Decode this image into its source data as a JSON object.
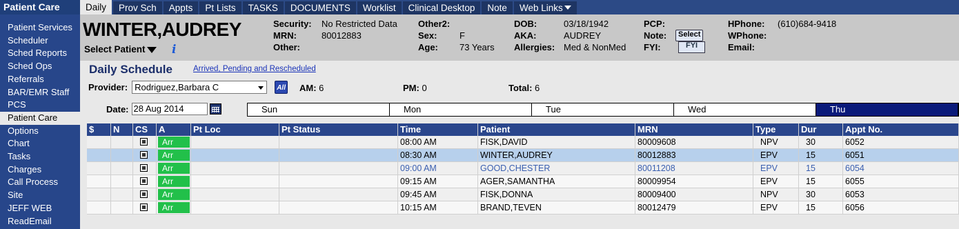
{
  "app": {
    "name": "Patient Care"
  },
  "tabs": [
    {
      "label": "Daily"
    },
    {
      "label": "Prov Sch"
    },
    {
      "label": "Appts"
    },
    {
      "label": "Pt Lists"
    },
    {
      "label": "TASKS"
    },
    {
      "label": "DOCUMENTS"
    },
    {
      "label": "Worklist"
    },
    {
      "label": "Clinical Desktop"
    },
    {
      "label": "Note"
    },
    {
      "label": "Web Links"
    }
  ],
  "sidebar": {
    "items": [
      {
        "label": "Patient Services"
      },
      {
        "label": "Scheduler"
      },
      {
        "label": "Sched Reports"
      },
      {
        "label": "Sched Ops"
      },
      {
        "label": "Referrals"
      },
      {
        "label": "BAR/EMR Staff"
      },
      {
        "label": "PCS"
      },
      {
        "label": "Patient Care"
      },
      {
        "label": "Options"
      },
      {
        "label": "Chart"
      },
      {
        "label": "Tasks"
      },
      {
        "label": "Charges"
      },
      {
        "label": "Call Process"
      },
      {
        "label": "Site"
      },
      {
        "label": "JEFF WEB"
      },
      {
        "label": "ReadEmail"
      }
    ]
  },
  "patient": {
    "name": "WINTER,AUDREY",
    "select_label": "Select Patient",
    "security_label": "Security:",
    "security": "No Restricted Data",
    "mrn_label": "MRN:",
    "mrn": "80012883",
    "other_label": "Other:",
    "other": "",
    "other2_label": "Other2:",
    "other2": "",
    "sex_label": "Sex:",
    "sex": "F",
    "age_label": "Age:",
    "age": "73 Years",
    "dob_label": "DOB:",
    "dob": "03/18/1942",
    "aka_label": "AKA:",
    "aka": "AUDREY",
    "allergies_label": "Allergies:",
    "allergies": "Med & NonMed",
    "pcp_label": "PCP:",
    "pcp": "",
    "note_label": "Note:",
    "note_button": "Select",
    "fyi_label": "FYI:",
    "fyi_button": "FYI",
    "hphone_label": "HPhone:",
    "hphone": "(610)684-9418",
    "wphone_label": "WPhone:",
    "wphone": "",
    "email_label": "Email:",
    "email": ""
  },
  "schedule": {
    "title": "Daily Schedule",
    "link": "Arrived, Pending and Rescheduled",
    "provider_label": "Provider:",
    "provider": "Rodriguez,Barbara C",
    "all_label": "All",
    "am_label": "AM:",
    "am": "6",
    "pm_label": "PM:",
    "pm": "0",
    "total_label": "Total:",
    "total": "6",
    "date_label": "Date:",
    "date": "28 Aug 2014",
    "days": [
      "Sun",
      "Mon",
      "Tue",
      "Wed",
      "Thu"
    ],
    "selected_day": "Thu"
  },
  "table": {
    "columns": [
      "$",
      "N",
      "CS",
      "A",
      "Pt Loc",
      "Pt Status",
      "Time",
      "Patient",
      "MRN",
      "Type",
      "Dur",
      "Appt No."
    ],
    "rows": [
      {
        "a": "Arr",
        "time": "08:00 AM",
        "patient": "FISK,DAVID",
        "mrn": "80009608",
        "type": "NPV",
        "dur": "30",
        "appt": "6052"
      },
      {
        "a": "Arr",
        "time": "08:30 AM",
        "patient": "WINTER,AUDREY",
        "mrn": "80012883",
        "type": "EPV",
        "dur": "15",
        "appt": "6051"
      },
      {
        "a": "Arr",
        "time": "09:00 AM",
        "patient": "GOOD,CHESTER",
        "mrn": "80011208",
        "type": "EPV",
        "dur": "15",
        "appt": "6054"
      },
      {
        "a": "Arr",
        "time": "09:15 AM",
        "patient": "AGER,SAMANTHA",
        "mrn": "80009954",
        "type": "EPV",
        "dur": "15",
        "appt": "6055"
      },
      {
        "a": "Arr",
        "time": "09:45 AM",
        "patient": "FISK,DONNA",
        "mrn": "80009400",
        "type": "NPV",
        "dur": "30",
        "appt": "6053"
      },
      {
        "a": "Arr",
        "time": "10:15 AM",
        "patient": "BRAND,TEVEN",
        "mrn": "80012479",
        "type": "EPV",
        "dur": "15",
        "appt": "6056"
      }
    ]
  },
  "colors": {
    "nav": "#2c4a86",
    "sidebar": "#27468a",
    "header": "#2a468c",
    "arrived": "#22c04a",
    "selected_day": "#0a1a7a",
    "selected_row": "#b7d0ec"
  }
}
